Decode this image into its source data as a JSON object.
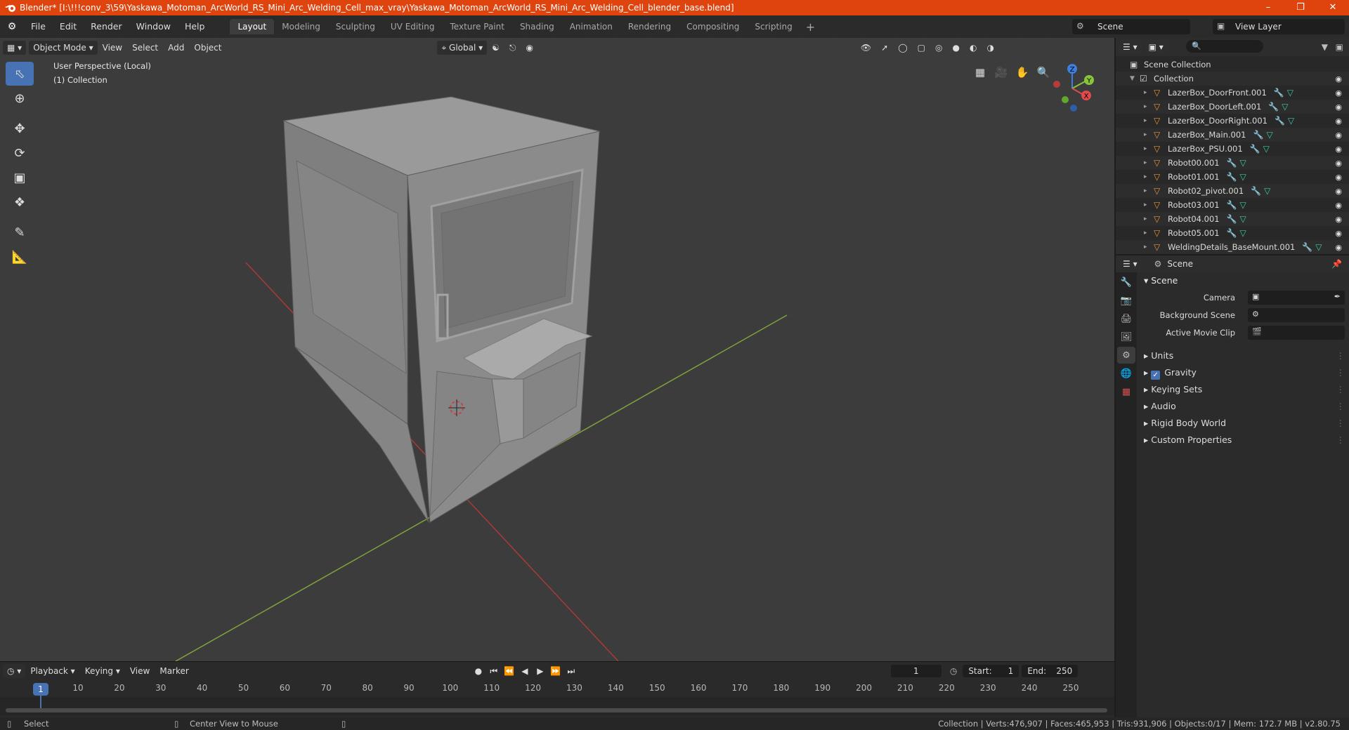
{
  "window": {
    "title": "Blender* [I:\\!!!conv_3\\59\\Yaskawa_Motoman_ArcWorld_RS_Mini_Arc_Welding_Cell_max_vray\\Yaskawa_Motoman_ArcWorld_RS_Mini_Arc_Welding_Cell_blender_base.blend]",
    "title_color": "#e0440e"
  },
  "menu": [
    "File",
    "Edit",
    "Render",
    "Window",
    "Help"
  ],
  "workspaces": [
    "Layout",
    "Modeling",
    "Sculpting",
    "UV Editing",
    "Texture Paint",
    "Shading",
    "Animation",
    "Rendering",
    "Compositing",
    "Scripting"
  ],
  "active_workspace": "Layout",
  "scene_selector": "Scene",
  "view_layer_selector": "View Layer",
  "viewport": {
    "mode": "Object Mode",
    "menus": [
      "View",
      "Select",
      "Add",
      "Object"
    ],
    "transform_orientation": "Global",
    "perspective_label": "User Perspective (Local)",
    "collection_label": "(1) Collection",
    "gizmo_axes": [
      "X",
      "Y",
      "Z"
    ]
  },
  "outliner": {
    "root": "Scene Collection",
    "collection": "Collection",
    "objects": [
      "LazerBox_DoorFront.001",
      "LazerBox_DoorLeft.001",
      "LazerBox_DoorRight.001",
      "LazerBox_Main.001",
      "LazerBox_PSU.001",
      "Robot00.001",
      "Robot01.001",
      "Robot02_pivot.001",
      "Robot03.001",
      "Robot04.001",
      "Robot05.001",
      "WeldingDetails_BaseMount.001"
    ]
  },
  "properties": {
    "context": "Scene",
    "panel": "Scene",
    "fields": [
      {
        "label": "Camera"
      },
      {
        "label": "Background Scene"
      },
      {
        "label": "Active Movie Clip"
      }
    ],
    "sub_panels": [
      "Units",
      "Gravity",
      "Keying Sets",
      "Audio",
      "Rigid Body World",
      "Custom Properties"
    ],
    "gravity_enabled": true
  },
  "timeline": {
    "menus": [
      "Playback",
      "Keying",
      "View",
      "Marker"
    ],
    "current_frame": "1",
    "start_label": "Start:",
    "start": "1",
    "end_label": "End:",
    "end": "250",
    "ticks": [
      "1",
      "10",
      "20",
      "30",
      "40",
      "50",
      "60",
      "70",
      "80",
      "90",
      "100",
      "110",
      "120",
      "130",
      "140",
      "150",
      "160",
      "170",
      "180",
      "190",
      "200",
      "210",
      "220",
      "230",
      "240",
      "250"
    ]
  },
  "status": {
    "left_action": "Select",
    "middle_action": "Center View to Mouse",
    "stats": "Collection | Verts:476,907 | Faces:465,953 | Tris:931,906 | Objects:0/17 | Mem: 172.7 MB | v2.80.75"
  },
  "colors": {
    "accent": "#4772b3",
    "viewport_bg": "#3c3c3c",
    "x_axis": "#e04a4a",
    "y_axis": "#8ac43a",
    "z_axis": "#3d7fe0"
  }
}
